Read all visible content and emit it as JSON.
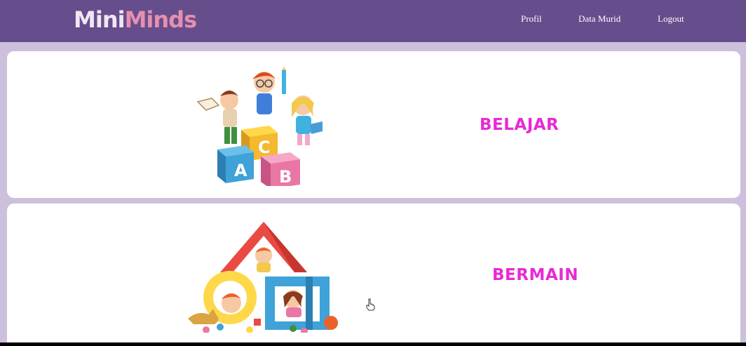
{
  "brand": {
    "part1": "Mini",
    "part2": "Minds"
  },
  "nav": {
    "items": [
      {
        "label": "Profil"
      },
      {
        "label": "Data Murid"
      },
      {
        "label": "Logout"
      }
    ]
  },
  "cards": [
    {
      "label": "BELAJAR",
      "icon": "kids-abc-blocks-icon"
    },
    {
      "label": "BERMAIN",
      "icon": "kids-playhouse-icon"
    }
  ],
  "colors": {
    "navbar": "#664d8b",
    "background": "#cdc0dc",
    "card_label": "#e72ad6",
    "logo_mini": "#f1e6f4",
    "logo_minds": "#e58fb0"
  }
}
